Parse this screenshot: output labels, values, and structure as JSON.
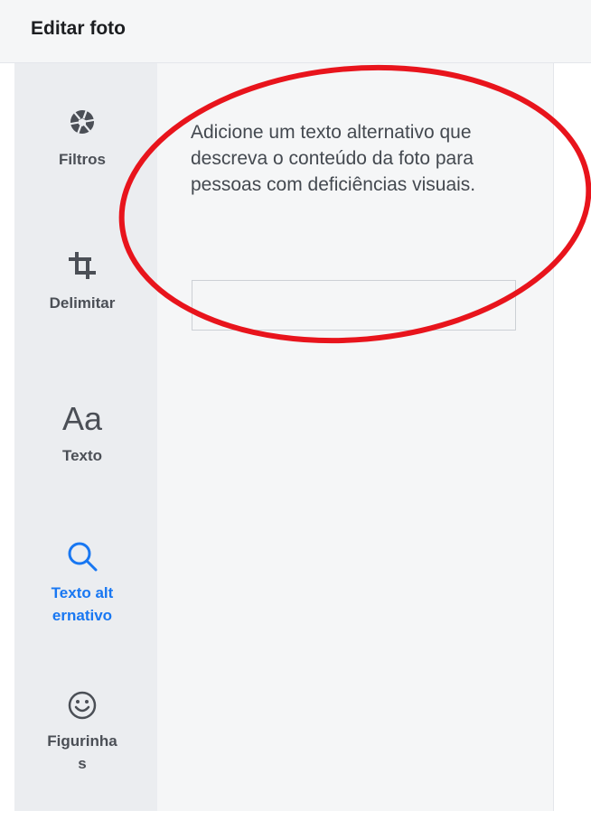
{
  "header": {
    "title": "Editar foto"
  },
  "sidebar": {
    "items": [
      {
        "label": "Filtros",
        "icon": "aperture-icon",
        "active": false
      },
      {
        "label": "Delimitar",
        "icon": "crop-icon",
        "active": false
      },
      {
        "label": "Texto",
        "icon": "text-aa-icon",
        "glyph": "Aa",
        "active": false
      },
      {
        "label": "Texto alternativo",
        "icon": "search-icon",
        "active": true
      },
      {
        "label": "Figurinhas",
        "icon": "smiley-icon",
        "active": false
      }
    ]
  },
  "panel": {
    "description": "Adicione um texto alternativo que descreva o conteúdo da foto para pessoas com deficiências visuais.",
    "input_value": "",
    "input_placeholder": ""
  },
  "colors": {
    "active": "#1877f2",
    "annotation": "#e8141c",
    "icon": "#4b4f56"
  }
}
